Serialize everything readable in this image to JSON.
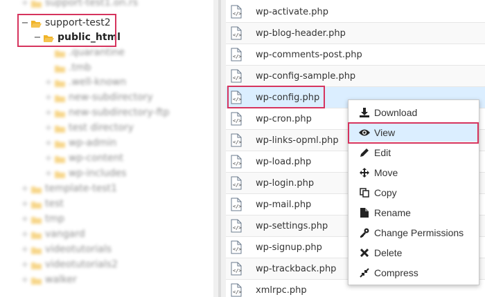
{
  "tree": {
    "items": [
      {
        "label": "support-test1.on.rs",
        "toggle": "+"
      },
      {
        "label": "support-test2",
        "toggle": "−"
      },
      {
        "label": "public_html",
        "toggle": "−"
      },
      {
        "label": ".quarantine",
        "toggle": ""
      },
      {
        "label": ".tmb",
        "toggle": ""
      },
      {
        "label": ".well-known",
        "toggle": "+"
      },
      {
        "label": "new-subdirectory",
        "toggle": "+"
      },
      {
        "label": "new-subdirectory-ftp",
        "toggle": "+"
      },
      {
        "label": "test directory",
        "toggle": "+"
      },
      {
        "label": "wp-admin",
        "toggle": "+"
      },
      {
        "label": "wp-content",
        "toggle": "+"
      },
      {
        "label": "wp-includes",
        "toggle": "+"
      },
      {
        "label": "template-test1",
        "toggle": "+"
      },
      {
        "label": "test",
        "toggle": "+"
      },
      {
        "label": "tmp",
        "toggle": "+"
      },
      {
        "label": "vangard",
        "toggle": "+"
      },
      {
        "label": "videotutorials",
        "toggle": "+"
      },
      {
        "label": "videotutorials2",
        "toggle": "+"
      },
      {
        "label": "walker",
        "toggle": "+"
      }
    ]
  },
  "files": [
    "wp-activate.php",
    "wp-blog-header.php",
    "wp-comments-post.php",
    "wp-config-sample.php",
    "wp-config.php",
    "wp-cron.php",
    "wp-links-opml.php",
    "wp-load.php",
    "wp-login.php",
    "wp-mail.php",
    "wp-settings.php",
    "wp-signup.php",
    "wp-trackback.php",
    "xmlrpc.php"
  ],
  "context_menu": {
    "items": [
      {
        "label": "Download",
        "icon": "download-icon"
      },
      {
        "label": "View",
        "icon": "eye-icon"
      },
      {
        "label": "Edit",
        "icon": "pencil-icon"
      },
      {
        "label": "Move",
        "icon": "move-icon"
      },
      {
        "label": "Copy",
        "icon": "copy-icon"
      },
      {
        "label": "Rename",
        "icon": "file-icon"
      },
      {
        "label": "Change Permissions",
        "icon": "key-icon"
      },
      {
        "label": "Delete",
        "icon": "close-icon"
      },
      {
        "label": "Compress",
        "icon": "compress-icon"
      }
    ]
  },
  "colors": {
    "folder": "#f0b429",
    "selected": "#dbeeff",
    "highlight_border": "#d6335d"
  }
}
